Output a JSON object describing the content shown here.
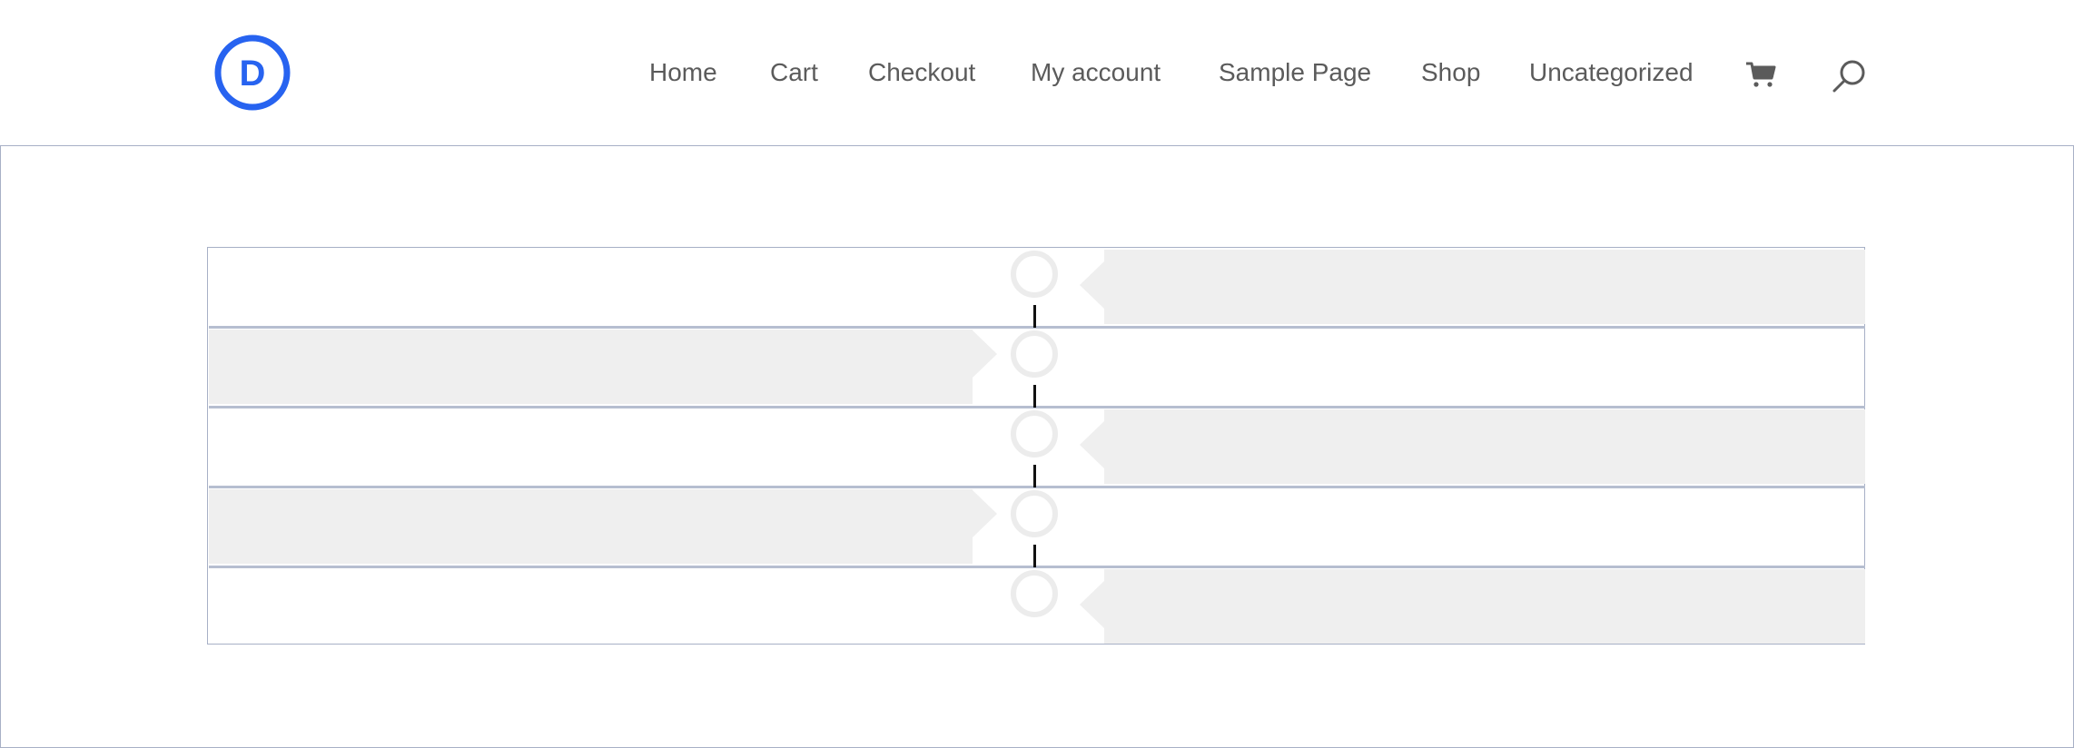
{
  "brand": {
    "logo_letter": "D",
    "color": "#2763f0"
  },
  "nav": {
    "items": [
      {
        "label": "Home"
      },
      {
        "label": "Cart"
      },
      {
        "label": "Checkout"
      },
      {
        "label": "My account"
      },
      {
        "label": "Sample Page"
      },
      {
        "label": "Shop"
      },
      {
        "label": "Uncategorized"
      }
    ],
    "icons": [
      "cart-icon",
      "search-icon"
    ]
  },
  "timeline": {
    "entries": [
      {
        "side": "right"
      },
      {
        "side": "left"
      },
      {
        "side": "right"
      },
      {
        "side": "left"
      },
      {
        "side": "right"
      }
    ],
    "colors": {
      "card": "#efefef",
      "dot_ring": "#ececec",
      "connector": "#111111",
      "divider": "#b6bed0"
    }
  }
}
